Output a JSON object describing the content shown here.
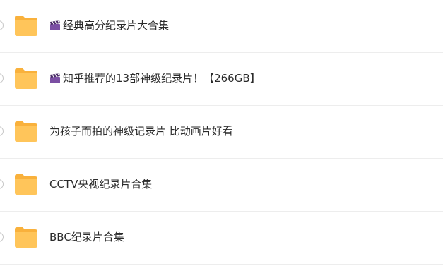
{
  "file_list": {
    "items": [
      {
        "name": "经典高分纪录片大合集",
        "type": "folder",
        "leading_icon": "clapper-board-icon"
      },
      {
        "name": "知乎推荐的13部神级纪录片！【266GB】",
        "type": "folder",
        "leading_icon": "clapper-board-icon"
      },
      {
        "name": "为孩子而拍的神级记录片 比动画片好看",
        "type": "folder",
        "leading_icon": ""
      },
      {
        "name": "CCTV央视纪录片合集",
        "type": "folder",
        "leading_icon": ""
      },
      {
        "name": "BBC纪录片合集",
        "type": "folder",
        "leading_icon": ""
      }
    ]
  },
  "colors": {
    "folder": "#FFC55A",
    "folder_tab": "#F9B13C",
    "text": "#2b2b2b",
    "divider": "#ededed",
    "clapper": "#7B4FA3"
  }
}
